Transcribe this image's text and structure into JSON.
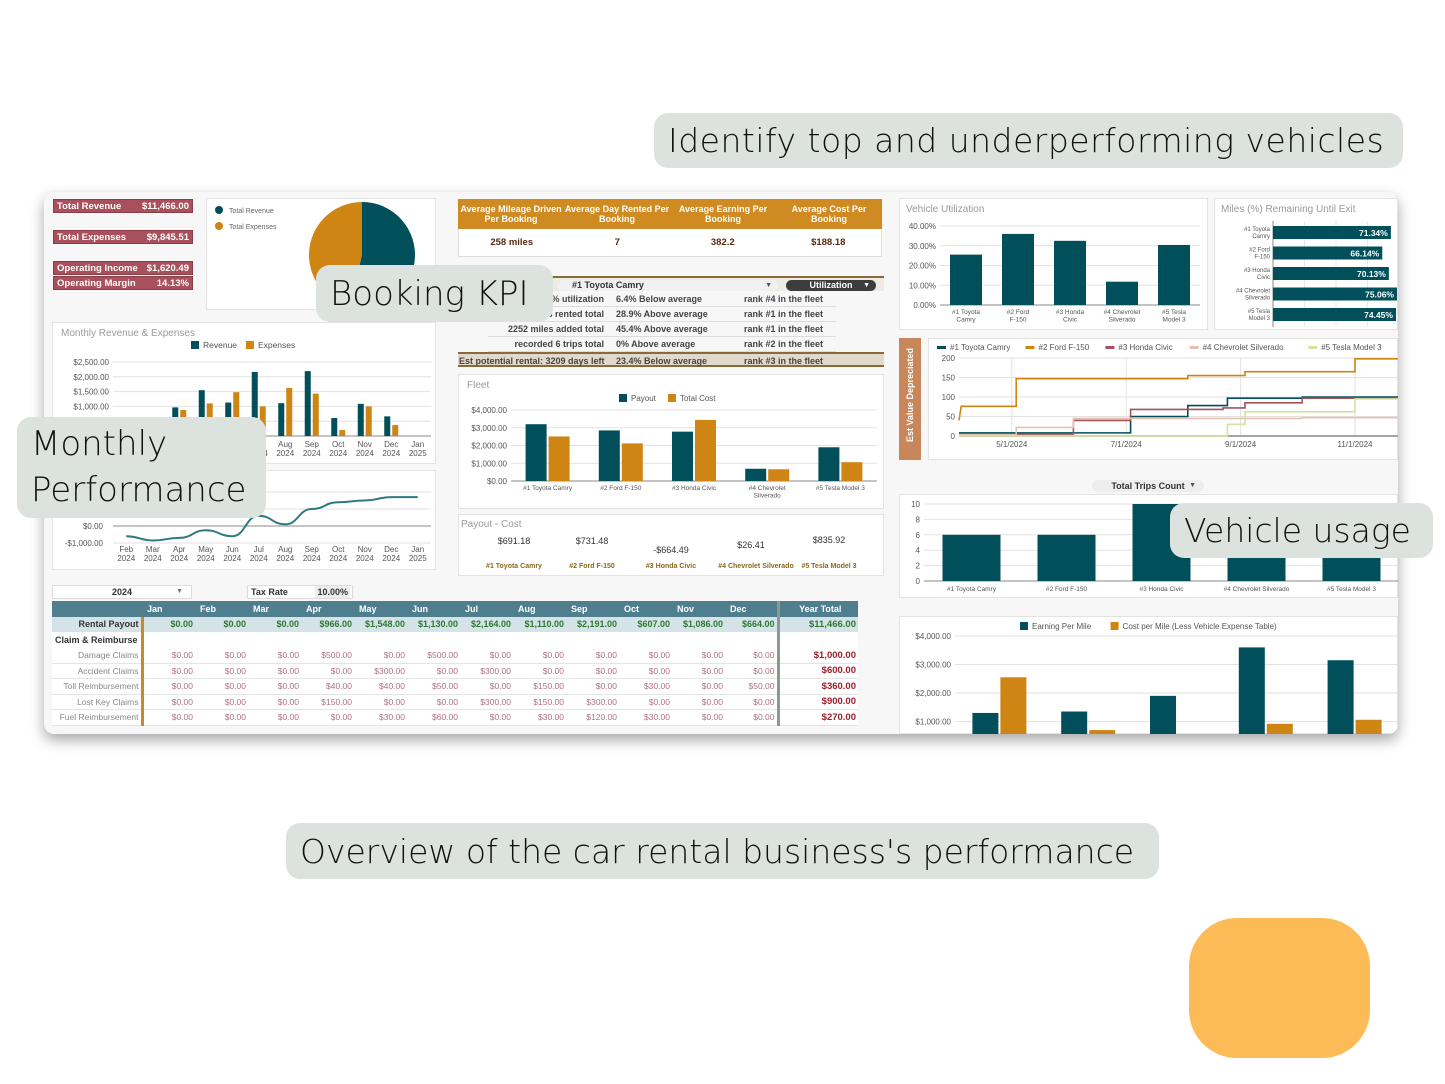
{
  "callouts": {
    "top": "Identify top and underperforming vehicles",
    "booking": "Booking KPI",
    "monthly_line1": "Monthly",
    "monthly_line2": "Performance",
    "usage": "Vehicle usage",
    "bottom": "Overview of the car rental business's performance"
  },
  "colors": {
    "teal": "#004f5a",
    "orange": "#cf8514",
    "kpi_red": "#a8505c",
    "callout_bg": "#dce3de",
    "blob": "#fdbb58"
  },
  "financial_kpis": [
    {
      "label": "Total Revenue",
      "value": "$11,466.00"
    },
    {
      "label": "Total Expenses",
      "value": "$9,845.51"
    },
    {
      "label": "Operating Income",
      "value": "$1,620.49"
    },
    {
      "label": "Operating Margin",
      "value": "14.13%"
    }
  ],
  "booking_kpis": {
    "headers": [
      "Average Mileage Driven Per Booking",
      "Average Day Rented Per Booking",
      "Average Earning Per Booking",
      "Average Cost Per Booking"
    ],
    "values": [
      "258 miles",
      "7",
      "382.2",
      "$188.18"
    ]
  },
  "vehicle_detail": {
    "vehicle_select": "#1 Toyota Camry",
    "metric_select": "Utilization",
    "rows": [
      {
        "stat": "6% utilization",
        "compare": "6.4% Below average",
        "rank": "rank #4 in the fleet"
      },
      {
        "stat": "ys rented total",
        "compare": "28.9% Above average",
        "rank": "rank #1 in the fleet"
      },
      {
        "stat": "2252 miles added total",
        "compare": "45.4% Above average",
        "rank": "rank #1 in the fleet"
      },
      {
        "stat": "recorded 6 trips total",
        "compare": "0% Above average",
        "rank": "rank #2 in the fleet"
      },
      {
        "stat": "Est potential rental: 3209 days left",
        "compare": "23.4% Below average",
        "rank": "rank #3 in the fleet"
      }
    ]
  },
  "payout_cost": {
    "title": "Payout - Cost",
    "items": [
      {
        "value": "$691.18",
        "name": "#1 Toyota Camry"
      },
      {
        "value": "$731.48",
        "name": "#2 Ford F-150"
      },
      {
        "value": "-$664.49",
        "name": "#3 Honda Civic"
      },
      {
        "value": "$26.41",
        "name": "#4 Chevrolet Silverado"
      },
      {
        "value": "$835.92",
        "name": "#5 Tesla Model 3"
      }
    ]
  },
  "trips_select": "Total Trips Count",
  "depreciation_tab": "Est Value Depreciated",
  "finance_table": {
    "year_select": "2024",
    "tax_rate_label": "Tax Rate",
    "tax_rate_value": "10.00%",
    "months": [
      "Jan",
      "Feb",
      "Mar",
      "Apr",
      "May",
      "Jun",
      "Jul",
      "Aug",
      "Sep",
      "Oct",
      "Nov",
      "Dec"
    ],
    "year_total_label": "Year Total",
    "payout": {
      "label": "Rental Payout",
      "values": [
        "$0.00",
        "$0.00",
        "$0.00",
        "$966.00",
        "$1,548.00",
        "$1,130.00",
        "$2,164.00",
        "$1,110.00",
        "$2,191.00",
        "$607.00",
        "$1,086.00",
        "$664.00"
      ],
      "total": "$11,466.00"
    },
    "section_label": "Claim & Reimburse",
    "rows": [
      {
        "label": "Damage Claims",
        "values": [
          "$0.00",
          "$0.00",
          "$0.00",
          "$500.00",
          "$0.00",
          "$500.00",
          "$0.00",
          "$0.00",
          "$0.00",
          "$0.00",
          "$0.00",
          "$0.00"
        ],
        "total": "$1,000.00"
      },
      {
        "label": "Accident Claims",
        "values": [
          "$0.00",
          "$0.00",
          "$0.00",
          "$0.00",
          "$300.00",
          "$0.00",
          "$300.00",
          "$0.00",
          "$0.00",
          "$0.00",
          "$0.00",
          "$0.00"
        ],
        "total": "$600.00"
      },
      {
        "label": "Toll Reimbursement",
        "values": [
          "$0.00",
          "$0.00",
          "$0.00",
          "$40.00",
          "$40.00",
          "$50.00",
          "$0.00",
          "$150.00",
          "$0.00",
          "$30.00",
          "$0.00",
          "$50.00"
        ],
        "total": "$360.00"
      },
      {
        "label": "Lost Key Claims",
        "values": [
          "$0.00",
          "$0.00",
          "$0.00",
          "$150.00",
          "$0.00",
          "$0.00",
          "$300.00",
          "$150.00",
          "$300.00",
          "$0.00",
          "$0.00",
          "$0.00"
        ],
        "total": "$900.00"
      },
      {
        "label": "Fuel Reimbursement",
        "values": [
          "$0.00",
          "$0.00",
          "$0.00",
          "$0.00",
          "$30.00",
          "$60.00",
          "$0.00",
          "$30.00",
          "$120.00",
          "$30.00",
          "$0.00",
          "$0.00"
        ],
        "total": "$270.00"
      }
    ]
  },
  "chart_data": [
    {
      "id": "rev-exp-pie",
      "type": "pie",
      "title": "",
      "legend": [
        "Total Revenue",
        "Total Expenses"
      ],
      "values": [
        11466.0,
        9845.51
      ],
      "legend_position": "top-left"
    },
    {
      "id": "monthly-rev-exp",
      "type": "bar",
      "title": "Monthly Revenue & Expenses",
      "categories": [
        "Feb 2024",
        "Mar 2024",
        "Apr 2024",
        "May 2024",
        "Jun 2024",
        "Jul 2024",
        "Aug 2024",
        "Sep 2024",
        "Oct 2024",
        "Nov 2024",
        "Dec 2024",
        "Jan 2025"
      ],
      "series": [
        {
          "name": "Revenue",
          "values": [
            0,
            0,
            966,
            1548,
            1130,
            2164,
            1110,
            2191,
            607,
            1086,
            664,
            0
          ]
        },
        {
          "name": "Expenses",
          "values": [
            0,
            0,
            880,
            1100,
            1480,
            1000,
            1620,
            1430,
            200,
            1000,
            370,
            0
          ]
        }
      ],
      "yticks": [
        "$1,000.00",
        "$1,500.00",
        "$2,000.00",
        "$2,500.00"
      ],
      "ylim": [
        0,
        2500
      ],
      "legend_position": "top"
    },
    {
      "id": "cumulative-income",
      "type": "line",
      "title": "",
      "categories": [
        "Feb 2024",
        "Mar 2024",
        "Apr 2024",
        "May 2024",
        "Jun 2024",
        "Jul 2024",
        "Aug 2024",
        "Sep 2024",
        "Oct 2024",
        "Nov 2024",
        "Dec 2024",
        "Jan 2025"
      ],
      "series": [
        {
          "name": "Operating Income",
          "values": [
            -600,
            -850,
            -700,
            -250,
            -600,
            600,
            100,
            1000,
            1400,
            1500,
            1700,
            1700
          ]
        }
      ],
      "yticks": [
        "-$1,000.00",
        "$0.00"
      ],
      "ylim": [
        -1000,
        2000
      ]
    },
    {
      "id": "fleet-payout-cost",
      "type": "bar",
      "title": "Fleet",
      "categories": [
        "#1 Toyota Camry",
        "#2 Ford F-150",
        "#3 Honda Civic",
        "#4 Chevrolet Silverado",
        "#5 Tesla Model 3"
      ],
      "series": [
        {
          "name": "Payout",
          "values": [
            3200,
            2850,
            2780,
            690,
            1900
          ]
        },
        {
          "name": "Total Cost",
          "values": [
            2510,
            2120,
            3440,
            660,
            1060
          ]
        }
      ],
      "yticks": [
        "$0.00",
        "$1,000.00",
        "$2,000.00",
        "$3,000.00",
        "$4,000.00"
      ],
      "ylim": [
        0,
        4000
      ],
      "legend_position": "top"
    },
    {
      "id": "vehicle-utilization",
      "type": "bar",
      "title": "Vehicle Utilization",
      "categories": [
        "#1 Toyota Camry",
        "#2 Ford F-150",
        "#3 Honda Civic",
        "#4 Chevrolet Silverado",
        "#5 Tesla Model 3"
      ],
      "values": [
        25.5,
        36,
        32.5,
        11.8,
        30.4
      ],
      "yticks": [
        "0.00%",
        "10.00%",
        "20.00%",
        "30.00%",
        "40.00%"
      ],
      "ylim": [
        0,
        40
      ]
    },
    {
      "id": "miles-remaining",
      "type": "bar",
      "title": "Miles (%) Remaining Until Exit",
      "categories": [
        "#1 Toyota Camry",
        "#2 Ford F-150",
        "#3 Honda Civic",
        "#4 Chevrolet Silverado",
        "#5 Tesla Model 3"
      ],
      "values": [
        71.34,
        66.14,
        70.13,
        75.06,
        74.45
      ],
      "labels": [
        "71.34%",
        "66.14%",
        "70.13%",
        "75.06%",
        "74.45%"
      ],
      "orientation": "horizontal"
    },
    {
      "id": "depreciation",
      "type": "line",
      "title": "Est Value Depreciated",
      "xticks": [
        "5/1/2024",
        "7/1/2024",
        "9/1/2024",
        "11/1/2024"
      ],
      "yticks": [
        "0",
        "50",
        "100",
        "150",
        "200"
      ],
      "ylim": [
        0,
        200
      ],
      "series": [
        {
          "name": "#1 Toyota Camry",
          "color": "#004f5a",
          "points": [
            [
              0,
              8
            ],
            [
              0.39,
              8
            ],
            [
              0.39,
              50
            ],
            [
              0.52,
              50
            ],
            [
              0.52,
              78
            ],
            [
              0.61,
              78
            ],
            [
              0.61,
              97
            ],
            [
              0.78,
              97
            ],
            [
              0.78,
              100
            ],
            [
              1,
              100
            ]
          ]
        },
        {
          "name": "#2 Ford F-150",
          "color": "#cf8514",
          "points": [
            [
              0,
              40
            ],
            [
              0.005,
              76
            ],
            [
              0.13,
              76
            ],
            [
              0.13,
              147
            ],
            [
              0.52,
              147
            ],
            [
              0.52,
              155
            ],
            [
              0.65,
              155
            ],
            [
              0.65,
              165
            ],
            [
              0.9,
              165
            ],
            [
              0.9,
              198
            ],
            [
              1,
              198
            ]
          ]
        },
        {
          "name": "#3 Honda Civic",
          "color": "#a8505c",
          "points": [
            [
              0,
              5
            ],
            [
              0.26,
              5
            ],
            [
              0.26,
              40
            ],
            [
              0.39,
              40
            ],
            [
              0.39,
              68
            ],
            [
              0.6,
              68
            ],
            [
              0.6,
              72
            ],
            [
              0.65,
              72
            ],
            [
              0.65,
              85
            ],
            [
              0.78,
              85
            ],
            [
              0.78,
              97
            ],
            [
              1,
              97
            ]
          ]
        },
        {
          "name": "#4 Chevrolet Silverado",
          "color": "#e6c0b0",
          "points": [
            [
              0,
              3
            ],
            [
              0.13,
              3
            ],
            [
              0.13,
              22
            ],
            [
              0.26,
              22
            ],
            [
              0.26,
              45
            ],
            [
              0.78,
              45
            ],
            [
              0.78,
              47
            ],
            [
              1,
              47
            ]
          ]
        },
        {
          "name": "#5 Tesla Model 3",
          "color": "#cfe3a0",
          "points": [
            [
              0,
              0
            ],
            [
              0.61,
              0
            ],
            [
              0.61,
              30
            ],
            [
              0.65,
              30
            ],
            [
              0.65,
              62
            ],
            [
              0.9,
              62
            ],
            [
              0.9,
              95
            ],
            [
              1,
              95
            ]
          ]
        }
      ],
      "legend_position": "top"
    },
    {
      "id": "total-trips",
      "type": "bar",
      "title": "Total Trips Count",
      "categories": [
        "#1 Toyota Camry",
        "#2 Ford F-150",
        "#3 Honda Civic",
        "#4 Chevrolet Silverado",
        "#5 Tesla Model 3"
      ],
      "values": [
        6,
        6,
        10,
        6,
        6
      ],
      "yticks": [
        "0",
        "2",
        "4",
        "6",
        "8",
        "10"
      ],
      "ylim": [
        0,
        10
      ]
    },
    {
      "id": "earning-cost-per-mile",
      "type": "bar",
      "title": "",
      "categories": [
        "#1 Toyota Camry",
        "#2 Ford F-150",
        "#3 Honda Civic",
        "#4 Chevrolet Silverado",
        "#5 Tesla Model 3"
      ],
      "series": [
        {
          "name": "Earning Per Mile",
          "values": [
            1300,
            1350,
            1900,
            3600,
            3150
          ]
        },
        {
          "name": "Cost per Mile (Less Vehicle Expense Table)",
          "values": [
            2550,
            700,
            0,
            920,
            1060
          ]
        }
      ],
      "yticks": [
        "$1,000.00",
        "$2,000.00",
        "$3,000.00",
        "$4,000.00"
      ],
      "ylim": [
        0,
        4000
      ],
      "legend_position": "top"
    }
  ]
}
